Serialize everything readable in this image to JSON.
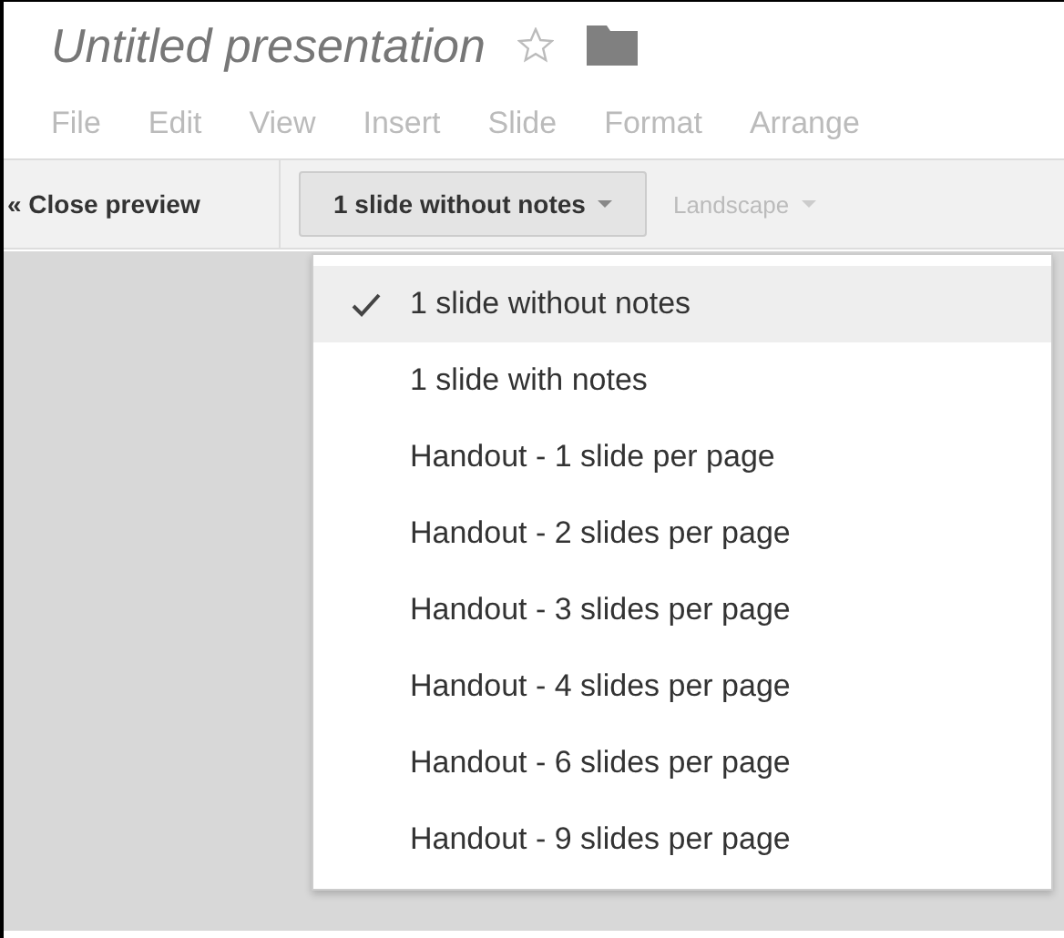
{
  "document": {
    "title": "Untitled presentation",
    "starred": false
  },
  "menu_bar": [
    {
      "label": "File",
      "disabled": true
    },
    {
      "label": "Edit",
      "disabled": true
    },
    {
      "label": "View",
      "disabled": true
    },
    {
      "label": "Insert",
      "disabled": true
    },
    {
      "label": "Slide",
      "disabled": true
    },
    {
      "label": "Format",
      "disabled": true
    },
    {
      "label": "Arrange",
      "disabled": true
    }
  ],
  "toolbar": {
    "close_preview": "« Close preview",
    "layout_dropdown": {
      "label": "1 slide without notes",
      "expanded": true
    },
    "orientation_dropdown": {
      "label": "Landscape",
      "disabled": true
    }
  },
  "layout_menu": [
    {
      "label": "1 slide without notes",
      "selected": true
    },
    {
      "label": "1 slide with notes",
      "selected": false
    },
    {
      "label": "Handout - 1 slide per page",
      "selected": false
    },
    {
      "label": "Handout - 2 slides per page",
      "selected": false
    },
    {
      "label": "Handout - 3 slides per page",
      "selected": false
    },
    {
      "label": "Handout - 4 slides per page",
      "selected": false
    },
    {
      "label": "Handout - 6 slides per page",
      "selected": false
    },
    {
      "label": "Handout - 9 slides per page",
      "selected": false
    }
  ]
}
